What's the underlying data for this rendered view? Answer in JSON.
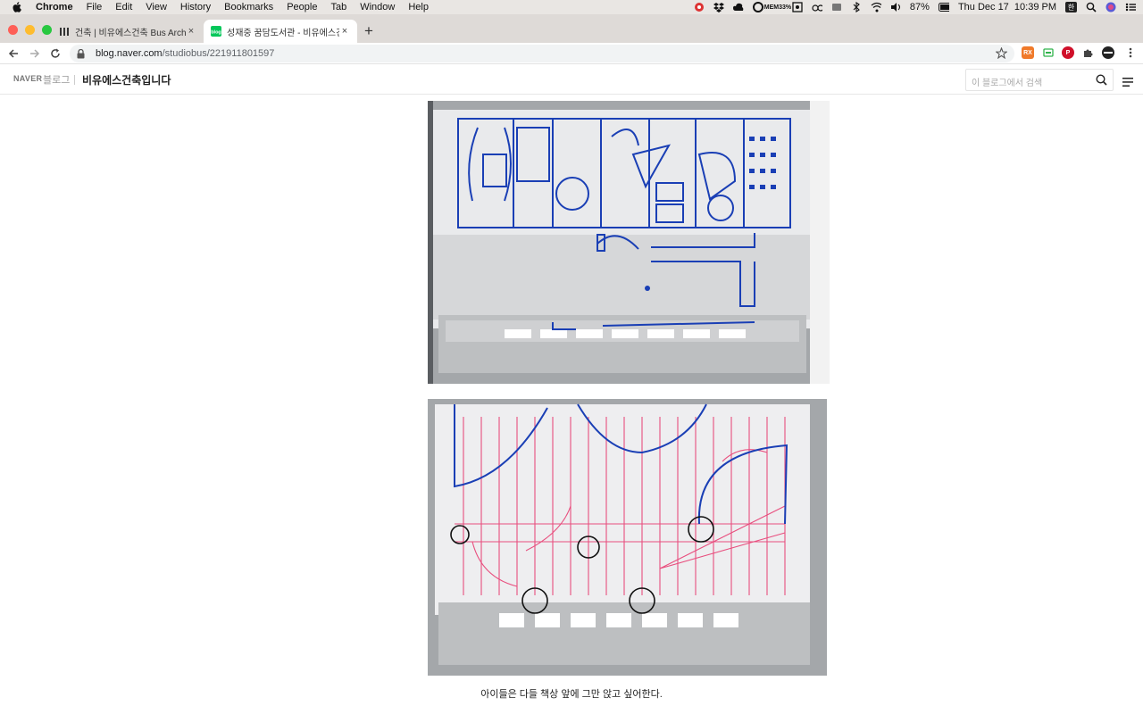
{
  "menubar": {
    "app": "Chrome",
    "items": [
      "File",
      "Edit",
      "View",
      "History",
      "Bookmarks",
      "People",
      "Tab",
      "Window",
      "Help"
    ],
    "mem_label": "MEM",
    "mem_value": "33%",
    "battery": "87%",
    "datetime": "Thu Dec 17  10:39 PM",
    "input_source": "한"
  },
  "tabs": [
    {
      "title": "건축 | 비유에스건축 Bus Architect",
      "favicon": "bus-logo-icon",
      "close": "×"
    },
    {
      "title": "성재중 꿈담도서관 - 비유에스건축 /",
      "favicon": "naver-blog-icon",
      "close": "×"
    }
  ],
  "newtab_label": "+",
  "toolbar": {
    "url_host": "blog.naver.com",
    "url_path": "/studiobus/221911801597"
  },
  "extensions": [
    {
      "name": "rss-extension-icon",
      "color": "#f07a2a",
      "label": "RX"
    },
    {
      "name": "green-extension-icon",
      "color": "#2fb34a",
      "label": ""
    },
    {
      "name": "pinterest-extension-icon",
      "color": "#d0102a",
      "label": "P"
    }
  ],
  "blog_header": {
    "brand": "NAVER",
    "brand_sub": "블로그",
    "title": "비유에스건축입니다",
    "search_placeholder": "이 블로그에서 검색"
  },
  "content": {
    "caption": "아이들은 다들 책상 앞에 그만 앉고 싶어한다."
  },
  "colors": {
    "sketch_blue": "#1a3fb5",
    "sketch_pink": "#e8336b",
    "model_gray": "#9ea1a4"
  }
}
